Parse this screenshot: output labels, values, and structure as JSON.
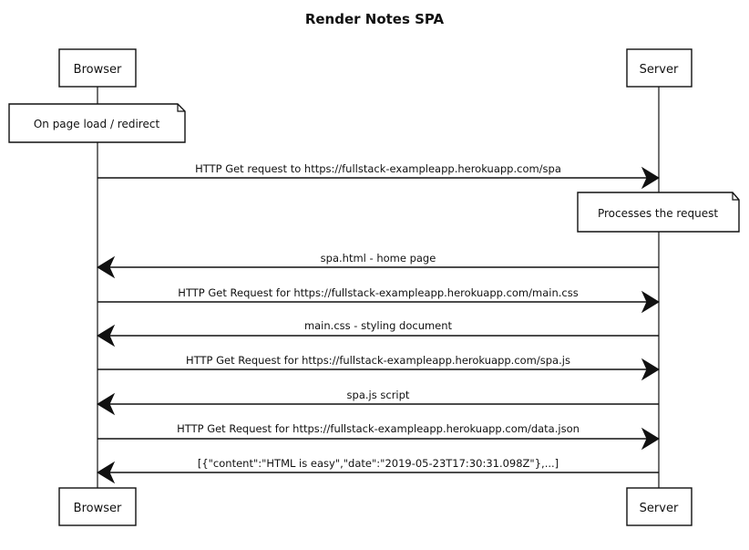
{
  "title": "Render Notes SPA",
  "actors": [
    {
      "id": "browser",
      "label": "Browser"
    },
    {
      "id": "server",
      "label": "Server"
    }
  ],
  "notes": [
    {
      "actor": "browser",
      "text": "On page load / redirect"
    },
    {
      "actor": "server",
      "text": "Processes the request"
    }
  ],
  "messages": [
    {
      "from": "browser",
      "to": "server",
      "text": "HTTP Get request to https://fullstack-exampleapp.herokuapp.com/spa"
    },
    {
      "from": "server",
      "to": "browser",
      "text": "spa.html - home page"
    },
    {
      "from": "browser",
      "to": "server",
      "text": "HTTP Get Request for https://fullstack-exampleapp.herokuapp.com/main.css"
    },
    {
      "from": "server",
      "to": "browser",
      "text": "main.css - styling document"
    },
    {
      "from": "browser",
      "to": "server",
      "text": "HTTP Get Request for https://fullstack-exampleapp.herokuapp.com/spa.js"
    },
    {
      "from": "server",
      "to": "browser",
      "text": "spa.js script"
    },
    {
      "from": "browser",
      "to": "server",
      "text": "HTTP Get Request for https://fullstack-exampleapp.herokuapp.com/data.json"
    },
    {
      "from": "server",
      "to": "browser",
      "text": "[{\"content\":\"HTML is easy\",\"date\":\"2019-05-23T17:30:31.098Z\"},...]"
    }
  ]
}
